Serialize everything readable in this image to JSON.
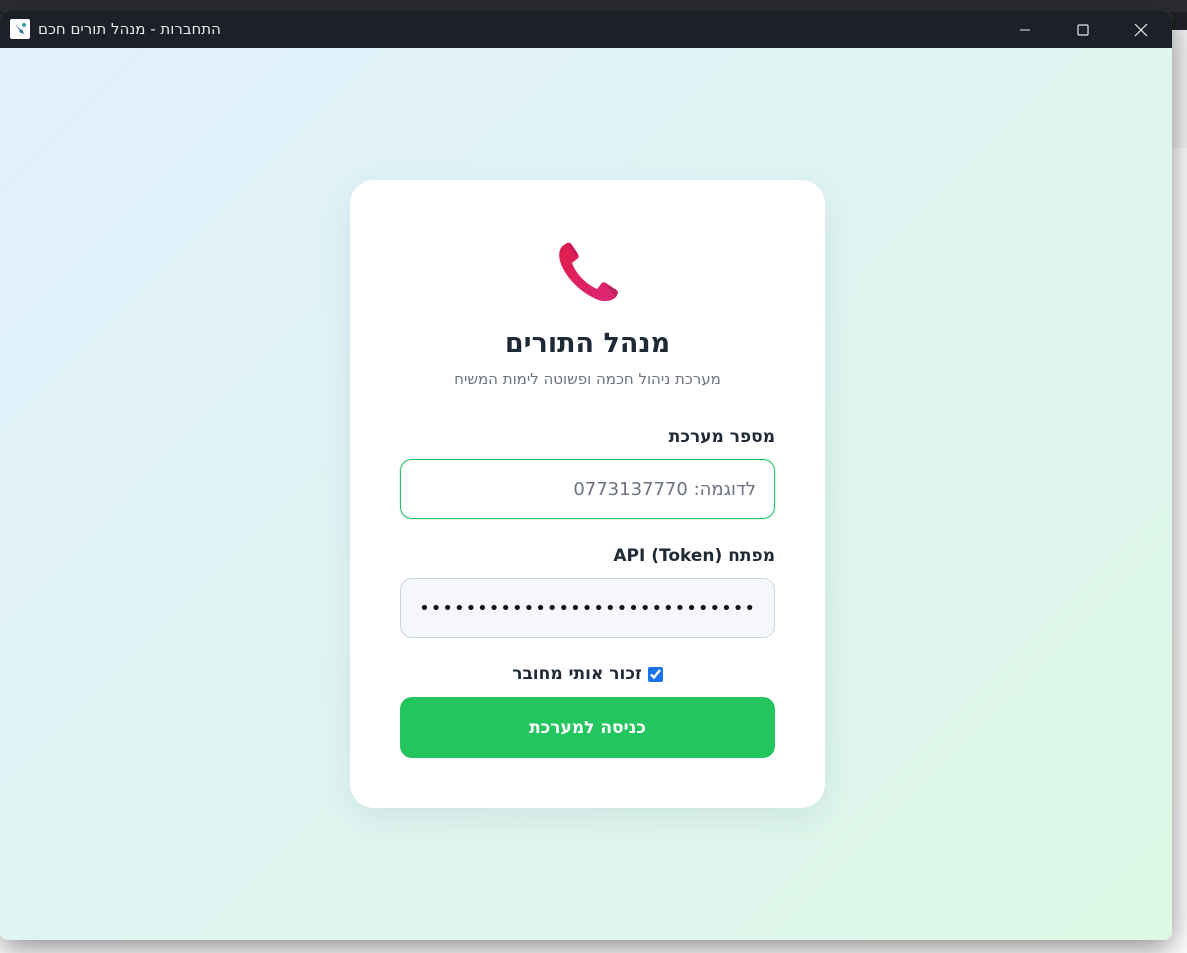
{
  "window": {
    "title": "התחברות - מנהל תורים חכם",
    "controls": {
      "minimize_icon": "minimize-icon",
      "maximize_icon": "maximize-icon",
      "close_icon": "close-icon"
    }
  },
  "login": {
    "icon": "phone-receiver-icon",
    "title": "מנהל התורים",
    "subtitle": "מערכת ניהול חכמה ופשוטה לימות המשיח",
    "system_number": {
      "label": "מספר מערכת",
      "value": "",
      "placeholder": "לדוגמה: 0773137770"
    },
    "token": {
      "label": "מפתח API (Token)",
      "masked_value": "•••••••••••••••••••••••••••••••••••••••••••••••"
    },
    "remember_me": {
      "label": "זכור אותי מחובר",
      "checked": true
    },
    "submit_label": "כניסה למערכת"
  },
  "colors": {
    "accent_green": "#22c55e",
    "title_dark": "#1f2a37",
    "subtitle_gray": "#6b7280",
    "titlebar_bg": "#1c2028"
  }
}
